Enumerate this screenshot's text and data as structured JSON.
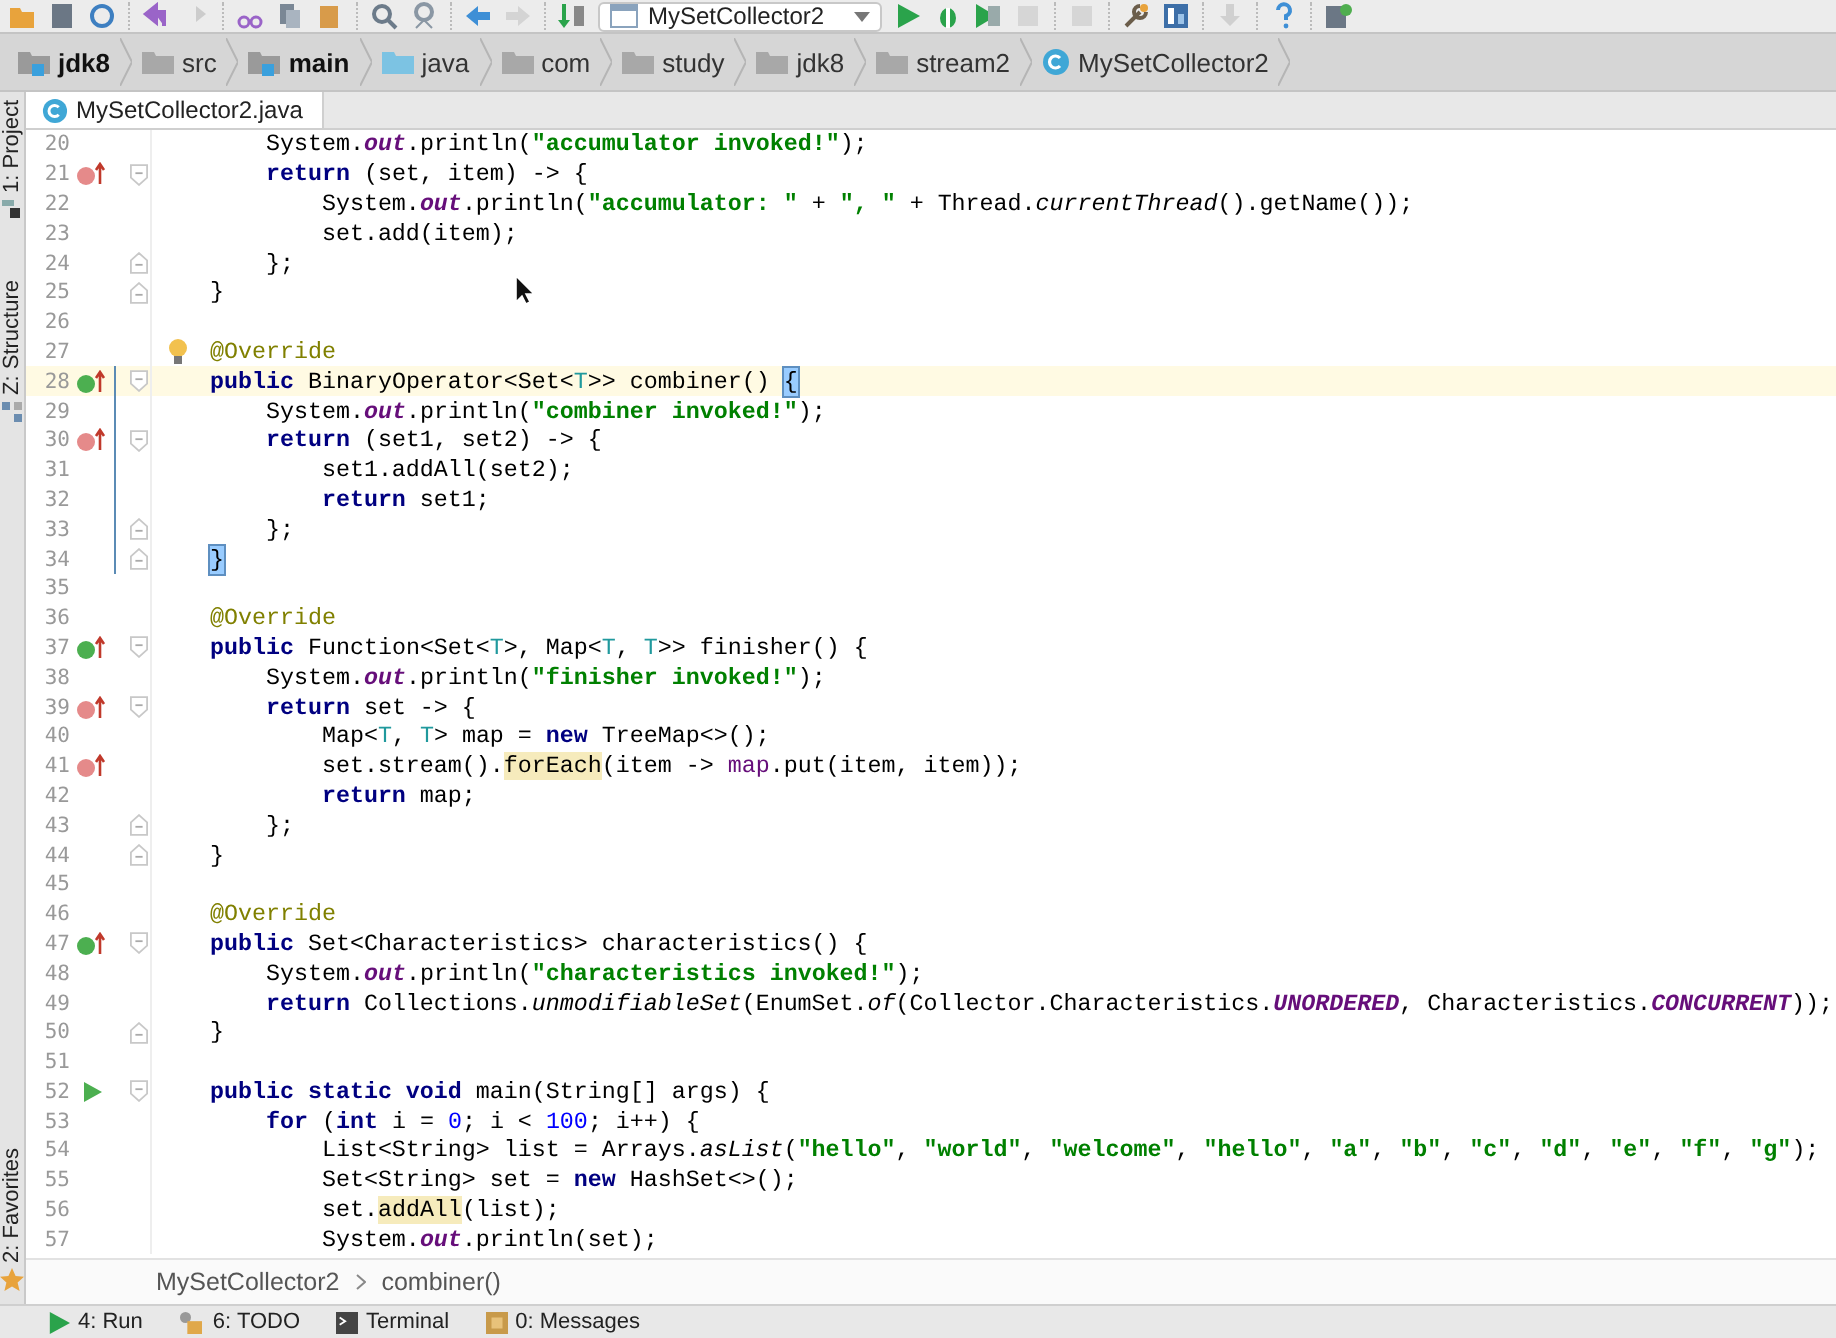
{
  "run_config": {
    "label": "MySetCollector2"
  },
  "breadcrumb": [
    {
      "label": "jdk8",
      "kind": "module"
    },
    {
      "label": "src",
      "kind": "folder"
    },
    {
      "label": "main",
      "kind": "module"
    },
    {
      "label": "java",
      "kind": "source"
    },
    {
      "label": "com",
      "kind": "folder"
    },
    {
      "label": "study",
      "kind": "folder"
    },
    {
      "label": "jdk8",
      "kind": "folder"
    },
    {
      "label": "stream2",
      "kind": "folder"
    },
    {
      "label": "MySetCollector2",
      "kind": "class"
    }
  ],
  "tabs": [
    {
      "label": "MySetCollector2.java",
      "selected": true
    }
  ],
  "side_tools": [
    {
      "label": "1: Project",
      "kind": "project"
    },
    {
      "label": "Z: Structure",
      "kind": "structure"
    },
    {
      "label": "2: Favorites",
      "kind": "favorites"
    }
  ],
  "lines": [
    {
      "n": "20",
      "tokens": [
        {
          "kind": "plain",
          "text": "    System."
        },
        {
          "kind": "field",
          "text": "out"
        },
        {
          "kind": "plain",
          "text": ".println("
        },
        {
          "kind": "string",
          "text": "\"accumulator invoked!\""
        },
        {
          "kind": "plain",
          "text": ");"
        }
      ]
    },
    {
      "n": "21",
      "implements": true,
      "fold_start": true,
      "tokens": [
        {
          "kind": "keyword",
          "text": "    return"
        },
        {
          "kind": "plain",
          "text": " (set, item) -> {"
        }
      ]
    },
    {
      "n": "22",
      "tokens": [
        {
          "kind": "plain",
          "text": "        System."
        },
        {
          "kind": "field",
          "text": "out"
        },
        {
          "kind": "plain",
          "text": ".println("
        },
        {
          "kind": "string",
          "text": "\"accumulator: \""
        },
        {
          "kind": "plain",
          "text": " + "
        },
        {
          "kind": "string",
          "text": "\", \""
        },
        {
          "kind": "plain",
          "text": " + Thread."
        },
        {
          "kind": "static",
          "text": "currentThread"
        },
        {
          "kind": "plain",
          "text": "().getName());"
        }
      ]
    },
    {
      "n": "23",
      "tokens": [
        {
          "kind": "plain",
          "text": "        set.add(item);"
        }
      ]
    },
    {
      "n": "24",
      "fold_end": true,
      "tokens": [
        {
          "kind": "plain",
          "text": "    };"
        }
      ]
    },
    {
      "n": "25",
      "fold_end": true,
      "tokens": [
        {
          "kind": "plain",
          "text": "}"
        }
      ]
    },
    {
      "n": "26"
    },
    {
      "n": "27",
      "bulb": true,
      "tokens": [
        {
          "kind": "annotation",
          "text": "@Override"
        }
      ]
    },
    {
      "n": "28",
      "overrides": true,
      "fold_start": true,
      "current": true,
      "scope": true,
      "tokens": [
        {
          "kind": "keyword",
          "text": "public"
        },
        {
          "kind": "plain",
          "text": " BinaryOperator<Set<"
        },
        {
          "kind": "type-param",
          "text": "T"
        },
        {
          "kind": "plain",
          "text": ">> combiner() "
        },
        {
          "kind": "brace",
          "text": "{"
        }
      ]
    },
    {
      "n": "29",
      "scope": true,
      "tokens": [
        {
          "kind": "plain",
          "text": "    System."
        },
        {
          "kind": "field",
          "text": "out"
        },
        {
          "kind": "plain",
          "text": ".println("
        },
        {
          "kind": "string",
          "text": "\"combiner invoked!\""
        },
        {
          "kind": "plain",
          "text": ");"
        }
      ]
    },
    {
      "n": "30",
      "implements": true,
      "fold_start": true,
      "scope": true,
      "tokens": [
        {
          "kind": "keyword",
          "text": "    return"
        },
        {
          "kind": "plain",
          "text": " (set1, set2) -> {"
        }
      ]
    },
    {
      "n": "31",
      "scope": true,
      "tokens": [
        {
          "kind": "plain",
          "text": "        set1.addAll(set2);"
        }
      ]
    },
    {
      "n": "32",
      "scope": true,
      "tokens": [
        {
          "kind": "keyword",
          "text": "        return"
        },
        {
          "kind": "plain",
          "text": " set1;"
        }
      ]
    },
    {
      "n": "33",
      "fold_end": true,
      "scope": true,
      "tokens": [
        {
          "kind": "plain",
          "text": "    };"
        }
      ]
    },
    {
      "n": "34",
      "fold_end": true,
      "scope": true,
      "tokens": [
        {
          "kind": "brace",
          "text": "}"
        }
      ]
    },
    {
      "n": "35"
    },
    {
      "n": "36",
      "tokens": [
        {
          "kind": "annotation",
          "text": "@Override"
        }
      ]
    },
    {
      "n": "37",
      "overrides": true,
      "fold_start": true,
      "tokens": [
        {
          "kind": "keyword",
          "text": "public"
        },
        {
          "kind": "plain",
          "text": " Function<Set<"
        },
        {
          "kind": "type-param",
          "text": "T"
        },
        {
          "kind": "plain",
          "text": ">, Map<"
        },
        {
          "kind": "type-param",
          "text": "T"
        },
        {
          "kind": "plain",
          "text": ", "
        },
        {
          "kind": "type-param",
          "text": "T"
        },
        {
          "kind": "plain",
          "text": ">> finisher() {"
        }
      ]
    },
    {
      "n": "38",
      "tokens": [
        {
          "kind": "plain",
          "text": "    System."
        },
        {
          "kind": "field",
          "text": "out"
        },
        {
          "kind": "plain",
          "text": ".println("
        },
        {
          "kind": "string",
          "text": "\"finisher invoked!\""
        },
        {
          "kind": "plain",
          "text": ");"
        }
      ]
    },
    {
      "n": "39",
      "implements": true,
      "fold_start": true,
      "tokens": [
        {
          "kind": "keyword",
          "text": "    return"
        },
        {
          "kind": "plain",
          "text": " set -> {"
        }
      ]
    },
    {
      "n": "40",
      "tokens": [
        {
          "kind": "plain",
          "text": "        Map<"
        },
        {
          "kind": "type-param",
          "text": "T"
        },
        {
          "kind": "plain",
          "text": ", "
        },
        {
          "kind": "type-param",
          "text": "T"
        },
        {
          "kind": "plain",
          "text": "> map = "
        },
        {
          "kind": "keyword",
          "text": "new"
        },
        {
          "kind": "plain",
          "text": " TreeMap<>();"
        }
      ]
    },
    {
      "n": "41",
      "implements": true,
      "tokens": [
        {
          "kind": "plain",
          "text": "        set.stream()."
        },
        {
          "kind": "usage",
          "text": "forEach"
        },
        {
          "kind": "plain",
          "text": "(item -> "
        },
        {
          "kind": "variable",
          "text": "map"
        },
        {
          "kind": "plain",
          "text": ".put(item, item));"
        }
      ]
    },
    {
      "n": "42",
      "tokens": [
        {
          "kind": "keyword",
          "text": "        return"
        },
        {
          "kind": "plain",
          "text": " map;"
        }
      ]
    },
    {
      "n": "43",
      "fold_end": true,
      "tokens": [
        {
          "kind": "plain",
          "text": "    };"
        }
      ]
    },
    {
      "n": "44",
      "fold_end": true,
      "tokens": [
        {
          "kind": "plain",
          "text": "}"
        }
      ]
    },
    {
      "n": "45"
    },
    {
      "n": "46",
      "tokens": [
        {
          "kind": "annotation",
          "text": "@Override"
        }
      ]
    },
    {
      "n": "47",
      "overrides": true,
      "fold_start": true,
      "tokens": [
        {
          "kind": "keyword",
          "text": "public"
        },
        {
          "kind": "plain",
          "text": " Set<Characteristics> characteristics() {"
        }
      ]
    },
    {
      "n": "48",
      "tokens": [
        {
          "kind": "plain",
          "text": "    System."
        },
        {
          "kind": "field",
          "text": "out"
        },
        {
          "kind": "plain",
          "text": ".println("
        },
        {
          "kind": "string",
          "text": "\"characteristics invoked!\""
        },
        {
          "kind": "plain",
          "text": ");"
        }
      ]
    },
    {
      "n": "49",
      "tokens": [
        {
          "kind": "keyword",
          "text": "    return"
        },
        {
          "kind": "plain",
          "text": " Collections."
        },
        {
          "kind": "static",
          "text": "unmodifiableSet"
        },
        {
          "kind": "plain",
          "text": "(EnumSet."
        },
        {
          "kind": "static",
          "text": "of"
        },
        {
          "kind": "plain",
          "text": "(Collector.Characteristics."
        },
        {
          "kind": "field",
          "text": "UNORDERED"
        },
        {
          "kind": "plain",
          "text": ", Characteristics."
        },
        {
          "kind": "field",
          "text": "CONCURRENT"
        },
        {
          "kind": "plain",
          "text": "));"
        }
      ]
    },
    {
      "n": "50",
      "fold_end": true,
      "tokens": [
        {
          "kind": "plain",
          "text": "}"
        }
      ]
    },
    {
      "n": "51"
    },
    {
      "n": "52",
      "runnable": true,
      "fold_start": true,
      "tokens": [
        {
          "kind": "keyword",
          "text": "public static void"
        },
        {
          "kind": "plain",
          "text": " main(String[] args) {"
        }
      ]
    },
    {
      "n": "53",
      "tokens": [
        {
          "kind": "keyword",
          "text": "    for"
        },
        {
          "kind": "plain",
          "text": " ("
        },
        {
          "kind": "keyword",
          "text": "int"
        },
        {
          "kind": "plain",
          "text": " i = "
        },
        {
          "kind": "number",
          "text": "0"
        },
        {
          "kind": "plain",
          "text": "; i < "
        },
        {
          "kind": "number",
          "text": "100"
        },
        {
          "kind": "plain",
          "text": "; i++) {"
        }
      ]
    },
    {
      "n": "54",
      "tokens": [
        {
          "kind": "plain",
          "text": "        List<String> list = Arrays."
        },
        {
          "kind": "static",
          "text": "asList"
        },
        {
          "kind": "plain",
          "text": "("
        },
        {
          "kind": "string",
          "text": "\"hello\""
        },
        {
          "kind": "plain",
          "text": ", "
        },
        {
          "kind": "string",
          "text": "\"world\""
        },
        {
          "kind": "plain",
          "text": ", "
        },
        {
          "kind": "string",
          "text": "\"welcome\""
        },
        {
          "kind": "plain",
          "text": ", "
        },
        {
          "kind": "string",
          "text": "\"hello\""
        },
        {
          "kind": "plain",
          "text": ", "
        },
        {
          "kind": "string",
          "text": "\"a\""
        },
        {
          "kind": "plain",
          "text": ", "
        },
        {
          "kind": "string",
          "text": "\"b\""
        },
        {
          "kind": "plain",
          "text": ", "
        },
        {
          "kind": "string",
          "text": "\"c\""
        },
        {
          "kind": "plain",
          "text": ", "
        },
        {
          "kind": "string",
          "text": "\"d\""
        },
        {
          "kind": "plain",
          "text": ", "
        },
        {
          "kind": "string",
          "text": "\"e\""
        },
        {
          "kind": "plain",
          "text": ", "
        },
        {
          "kind": "string",
          "text": "\"f\""
        },
        {
          "kind": "plain",
          "text": ", "
        },
        {
          "kind": "string",
          "text": "\"g\""
        },
        {
          "kind": "plain",
          "text": ");"
        }
      ]
    },
    {
      "n": "55",
      "tokens": [
        {
          "kind": "plain",
          "text": "        Set<String> set = "
        },
        {
          "kind": "keyword",
          "text": "new"
        },
        {
          "kind": "plain",
          "text": " HashSet<>();"
        }
      ]
    },
    {
      "n": "56",
      "tokens": [
        {
          "kind": "plain",
          "text": "        set."
        },
        {
          "kind": "usage",
          "text": "addAll"
        },
        {
          "kind": "plain",
          "text": "(list);"
        }
      ]
    },
    {
      "n": "57",
      "tokens": [
        {
          "kind": "plain",
          "text": "        System."
        },
        {
          "kind": "field",
          "text": "out"
        },
        {
          "kind": "plain",
          "text": ".println(set);"
        }
      ]
    }
  ],
  "editor_breadcrumb": [
    "MySetCollector2",
    "combiner()"
  ],
  "bottom_tools": [
    {
      "label": "4: Run",
      "kind": "run"
    },
    {
      "label": "6: TODO",
      "kind": "todo"
    },
    {
      "label": "Terminal",
      "kind": "terminal"
    },
    {
      "label": "0: Messages",
      "kind": "messages"
    }
  ]
}
